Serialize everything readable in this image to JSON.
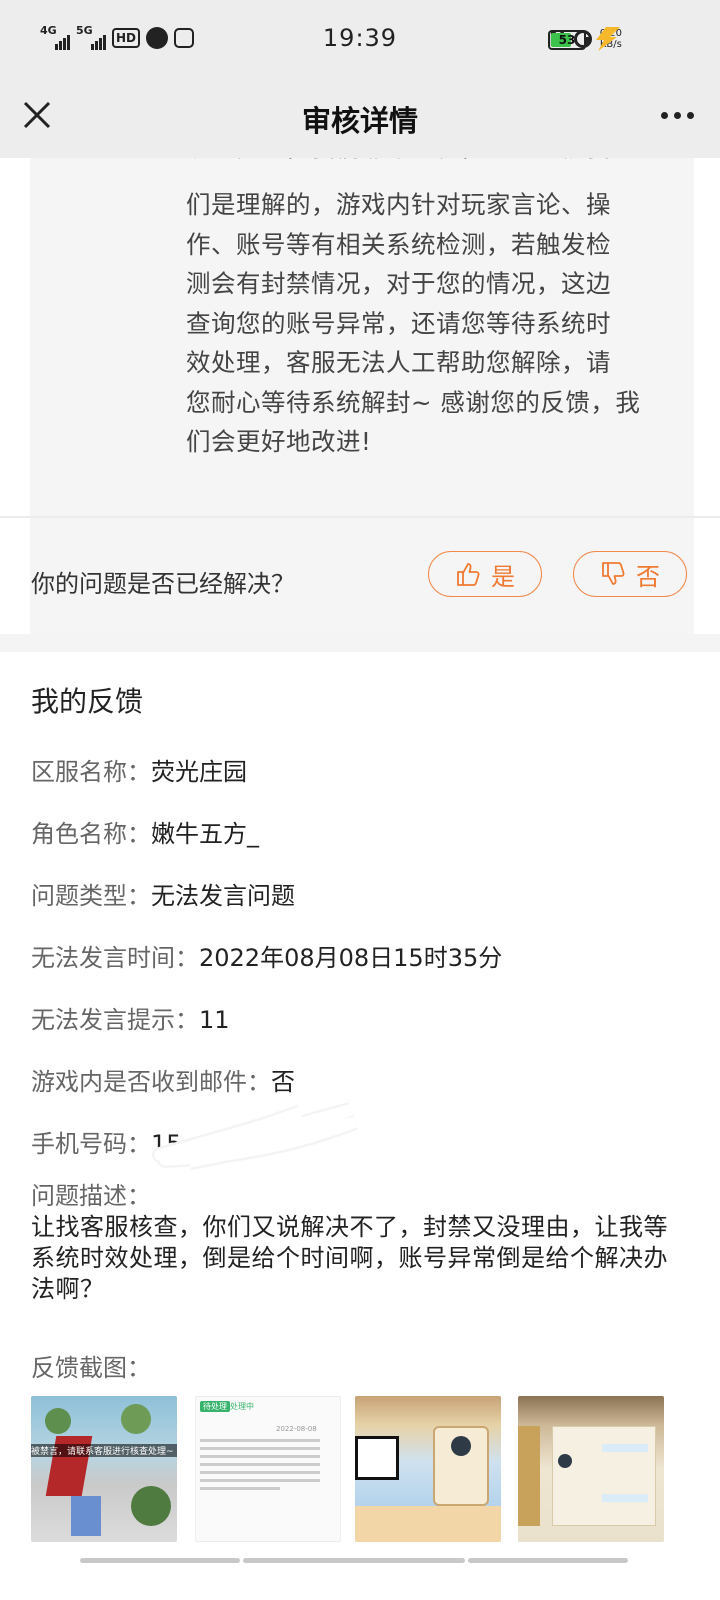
{
  "status_bar": {
    "network1": "4G",
    "network2": "5G",
    "hd": "HD",
    "time": "19:39",
    "speed_value": "0.20",
    "speed_unit": "KB/s",
    "battery": "53"
  },
  "navbar": {
    "title": "审核详情",
    "close_icon": "close-icon",
    "more_icon": "more-icon"
  },
  "reply": {
    "lines": [
      "们是理解的，游戏内针对玩家言论、操",
      "作、账号等有相关系统检测，若触发检",
      "测会有封禁情况，对于您的情况，这边",
      "查询您的账号异常，还请您等待系统时",
      "效处理，客服无法人工帮助您解除，请",
      "您耐心等待系统解封~ 感谢您的反馈，我",
      "们会更好地改进!"
    ]
  },
  "resolved": {
    "question": "你的问题是否已经解决？",
    "yes_label": "是",
    "no_label": "否",
    "accent_color": "#f07a32"
  },
  "feedback": {
    "title": "我的反馈",
    "fields": [
      {
        "label": "区服名称：",
        "value": "荧光庄园"
      },
      {
        "label": "角色名称：",
        "value": "嫩牛五方_"
      },
      {
        "label": "问题类型：",
        "value": "无法发言问题"
      },
      {
        "label": "无法发言时间：",
        "value": "2022年08月08日15时35分"
      },
      {
        "label": "无法发言提示：",
        "value": "11"
      },
      {
        "label": "游戏内是否收到邮件：",
        "value": "否"
      },
      {
        "label": "手机号码：",
        "value": "15"
      }
    ],
    "description_label": "问题描述：",
    "description_text": "让找客服核查，你们又说解决不了，封禁又没理由，让我等系统时效处理，倒是给个时间啊，账号异常倒是给个解决办法啊？",
    "screenshots_label": "反馈截图：",
    "screenshot_texts": {
      "t1_banner": "被禁言，请联系客服进行核查处理~",
      "t2_badge": "待处理",
      "t2_status": "处理中",
      "t2_date": "2022-08-08"
    }
  }
}
